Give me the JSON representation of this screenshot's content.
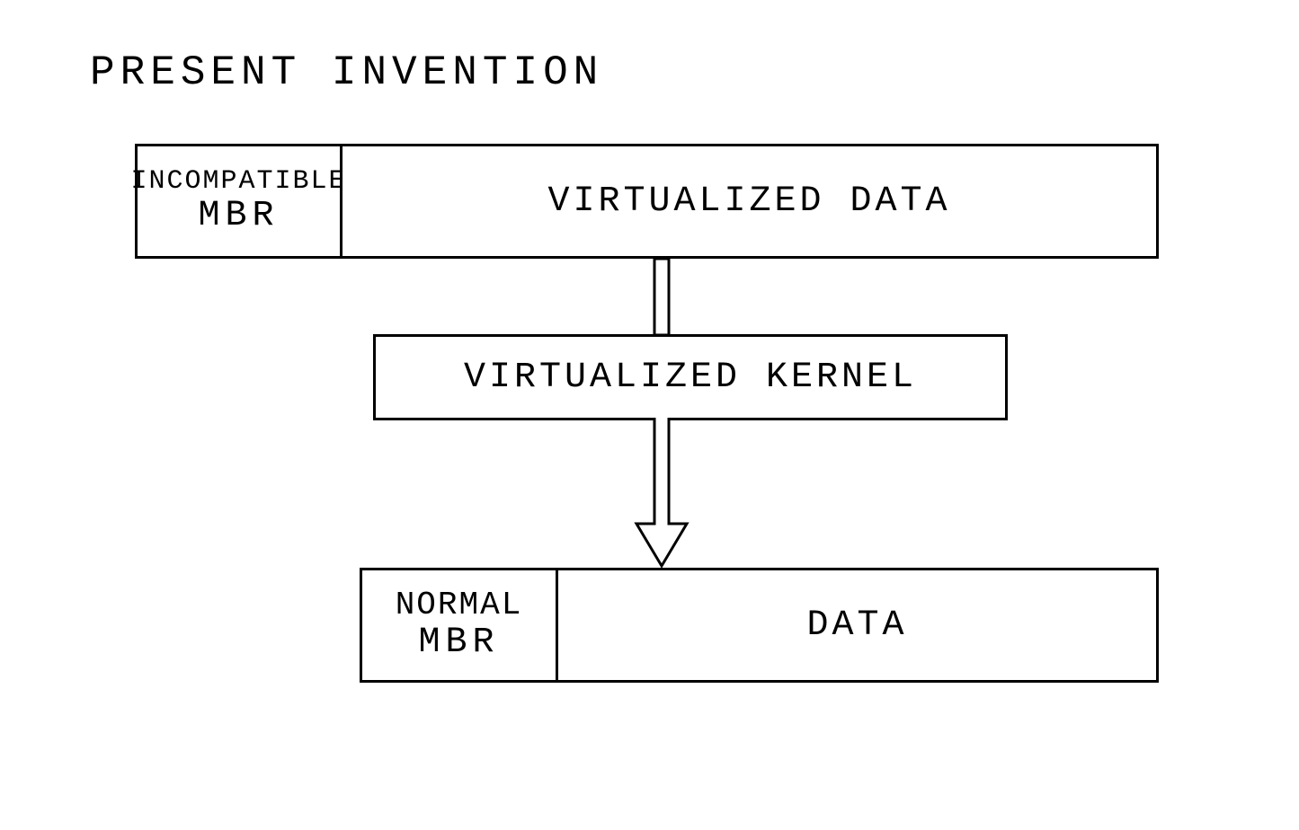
{
  "title": "PRESENT INVENTION",
  "top_row": {
    "left_line1": "INCOMPATIBLE",
    "left_line2": "MBR",
    "right": "VIRTUALIZED DATA"
  },
  "middle_box": "VIRTUALIZED KERNEL",
  "bottom_row": {
    "left_line1": "NORMAL",
    "left_line2": "MBR",
    "right": "DATA"
  }
}
